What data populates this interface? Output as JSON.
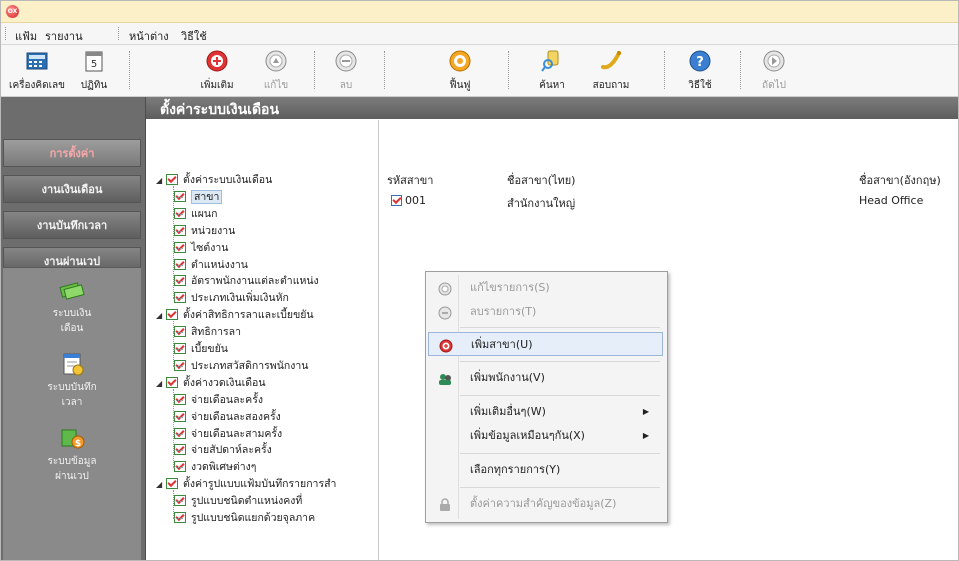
{
  "menu": {
    "items": [
      "แฟ้ม",
      "รายงาน",
      "หน้าต่าง",
      "วิธีใช้"
    ]
  },
  "toolbar": {
    "buttons": [
      {
        "label": "เครื่องคิดเลข",
        "icon": "calculator-icon",
        "enabled": true
      },
      {
        "label": "ปฏิทิน",
        "icon": "calendar-icon",
        "enabled": true
      },
      {
        "label": "เพิ่มเติม",
        "icon": "add-icon",
        "enabled": true
      },
      {
        "label": "แก้ไข",
        "icon": "edit-icon",
        "enabled": false
      },
      {
        "label": "ลบ",
        "icon": "delete-icon",
        "enabled": false
      },
      {
        "label": "ฟื้นฟู",
        "icon": "refresh-icon",
        "enabled": true
      },
      {
        "label": "ค้นหา",
        "icon": "search-icon",
        "enabled": true
      },
      {
        "label": "สอบถาม",
        "icon": "query-icon",
        "enabled": true
      },
      {
        "label": "วิธีใช้",
        "icon": "help-icon",
        "enabled": true
      },
      {
        "label": "ถัดไป",
        "icon": "next-icon",
        "enabled": false
      }
    ]
  },
  "leftnav": {
    "buttons": [
      "การตั้งค่า",
      "งานเงินเดือน",
      "งานบันทึกเวลา",
      "งานผ่านเวป"
    ],
    "modules": [
      {
        "label_line1": "ระบบเงิน",
        "label_line2": "เดือน",
        "icon": "money-icon"
      },
      {
        "label_line1": "ระบบบันทึก",
        "label_line2": "เวลา",
        "icon": "time-record-icon"
      },
      {
        "label_line1": "ระบบข้อมูล",
        "label_line2": "ผ่านเวป",
        "icon": "web-data-icon"
      }
    ]
  },
  "header": {
    "title": "ตั้งค่าระบบเงินเดือน"
  },
  "tree": {
    "nodes": [
      {
        "label": "ตั้งค่าระบบเงินเดือน",
        "level": 0,
        "expanded": true
      },
      {
        "label": "สาขา",
        "level": 1,
        "selected": true
      },
      {
        "label": "แผนก",
        "level": 1
      },
      {
        "label": "หน่วยงาน",
        "level": 1
      },
      {
        "label": "ไซต์งาน",
        "level": 1
      },
      {
        "label": "ตำแหน่งงาน",
        "level": 1
      },
      {
        "label": "อัตราพนักงานแต่ละตำแหน่ง",
        "level": 1
      },
      {
        "label": "ประเภทเงินเพิ่มเงินหัก",
        "level": 1
      },
      {
        "label": "ตั้งค่าสิทธิการลาและเบี้ยขยัน",
        "level": 0,
        "expanded": true
      },
      {
        "label": "สิทธิการลา",
        "level": 1
      },
      {
        "label": "เบี้ยขยัน",
        "level": 1
      },
      {
        "label": "ประเภทสวัสดิการพนักงาน",
        "level": 1
      },
      {
        "label": "ตั้งค่างวดเงินเดือน",
        "level": 0,
        "expanded": true
      },
      {
        "label": "จ่ายเดือนละครั้ง",
        "level": 1
      },
      {
        "label": "จ่ายเดือนละสองครั้ง",
        "level": 1
      },
      {
        "label": "จ่ายเดือนละสามครั้ง",
        "level": 1
      },
      {
        "label": "จ่ายสัปดาห์ละครั้ง",
        "level": 1
      },
      {
        "label": "งวดพิเศษต่างๆ",
        "level": 1
      },
      {
        "label": "ตั้งค่ารูปแบบแฟ้มบันทึกรายการสำ",
        "level": 0,
        "expanded": true
      },
      {
        "label": "รูปแบบชนิดตำแหน่งคงที่",
        "level": 1
      },
      {
        "label": "รูปแบบชนิดแยกด้วยจุลภาค",
        "level": 1
      }
    ]
  },
  "table": {
    "columns": [
      "รหัสสาขา",
      "ชื่อสาขา(ไทย)",
      "ชื่อสาขา(อังกฤษ)"
    ],
    "rows": [
      {
        "code": "001",
        "name_th": "สำนักงานใหญ่",
        "name_en": "Head Office"
      }
    ]
  },
  "context_menu": {
    "items": [
      {
        "label": "แก้ไขรายการ(S)",
        "enabled": false,
        "icon": "edit-icon"
      },
      {
        "label": "ลบรายการ(T)",
        "enabled": false,
        "icon": "delete-icon"
      },
      {
        "label": "เพิ่มสาขา(U)",
        "enabled": true,
        "icon": "add-icon",
        "highlighted": true
      },
      {
        "label": "เพิ่มพนักงาน(V)",
        "enabled": true,
        "icon": "add-employee-icon"
      },
      {
        "label": "เพิ่มเติมอื่นๆ(W)",
        "enabled": true,
        "submenu": true
      },
      {
        "label": "เพิ่มข้อมูลเหมือนๆกัน(X)",
        "enabled": true,
        "submenu": true
      },
      {
        "label": "เลือกทุกรายการ(Y)",
        "enabled": true
      },
      {
        "label": "ตั้งค่าความสำคัญของข้อมูล(Z)",
        "enabled": false,
        "icon": "lock-icon"
      }
    ]
  },
  "colors": {
    "accent_red": "#d42121",
    "nav_bg": "#6d6d6d",
    "active_nav_text": "#f7a8a8",
    "menu_highlight": "#e5eef9"
  }
}
